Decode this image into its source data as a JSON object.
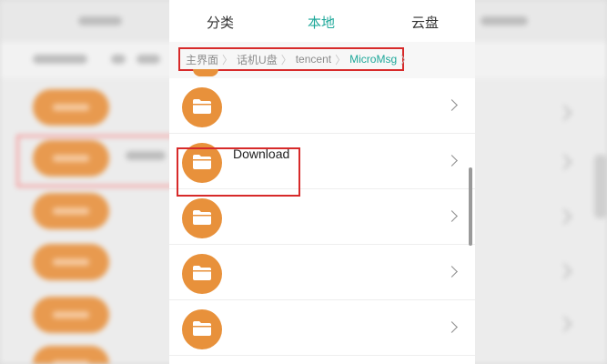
{
  "tabs": [
    {
      "label": "分类"
    },
    {
      "label": "本地"
    },
    {
      "label": "云盘"
    }
  ],
  "active_tab": "本地",
  "breadcrumb": [
    {
      "label": "主界面"
    },
    {
      "label": "话机U盘"
    },
    {
      "label": "tencent"
    },
    {
      "label": "MicroMsg"
    }
  ],
  "folders": [
    {
      "label": ""
    },
    {
      "label": "Download"
    },
    {
      "label": ""
    },
    {
      "label": ""
    },
    {
      "label": ""
    }
  ],
  "colors": {
    "accent": "#1fa89a",
    "folder": "#e8913b",
    "annotation": "#d72a2a"
  },
  "icons": {
    "folder": "folder-icon",
    "chevron": "chevron-right-icon"
  }
}
